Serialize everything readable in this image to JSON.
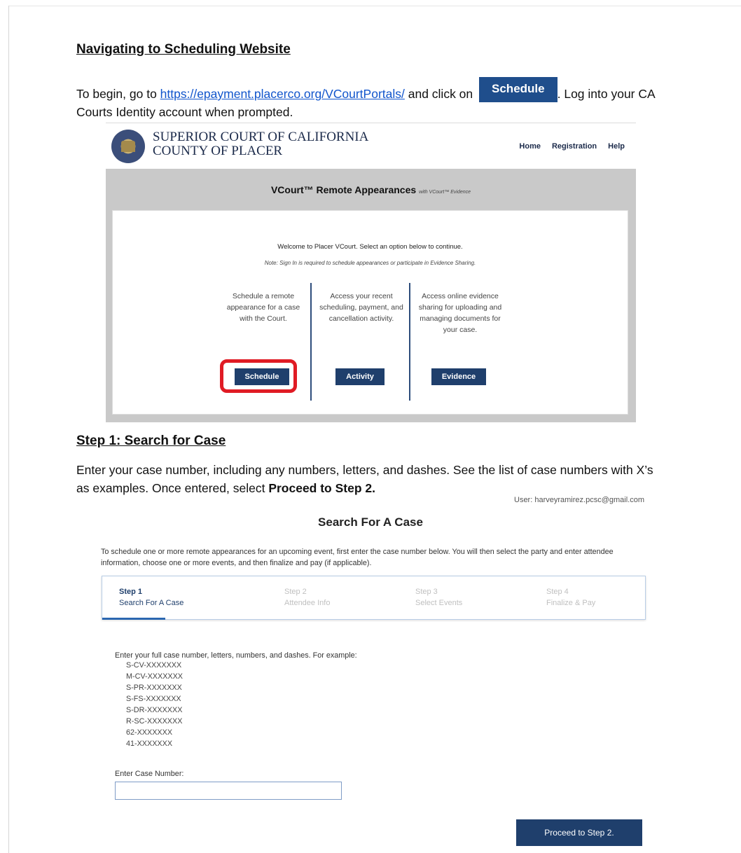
{
  "section1": {
    "heading": "Navigating to Scheduling Website",
    "intro_before": "To begin, go to ",
    "link": "https://epayment.placerco.org/VCourtPortals/",
    "intro_middle": " and click on ",
    "inline_button": "Schedule",
    "intro_after": ". Log into your CA Courts Identity account when prompted."
  },
  "vcourt": {
    "court_line1": "SUPERIOR COURT OF CALIFORNIA",
    "court_line2": "COUNTY OF PLACER",
    "nav": [
      "Home",
      "Registration",
      "Help"
    ],
    "band_title": "VCourt™ Remote Appearances",
    "band_subtitle": "with VCourt™ Evidence",
    "welcome": "Welcome to Placer VCourt. Select an option below to continue.",
    "note": "Note: Sign In is required to schedule appearances or participate in Evidence Sharing.",
    "options": [
      {
        "text": "Schedule a remote appearance for a case with the Court.",
        "button": "Schedule"
      },
      {
        "text": "Access your recent scheduling, payment, and cancellation activity.",
        "button": "Activity"
      },
      {
        "text": "Access online evidence sharing for uploading and managing documents for your case.",
        "button": "Evidence"
      }
    ]
  },
  "section2": {
    "heading": "Step 1: Search for Case",
    "para_text": "Enter your case number, including any numbers, letters, and dashes. See the list of case numbers with X’s as examples. Once entered, select ",
    "para_bold": "Proceed to Step 2."
  },
  "search": {
    "user": "User: harveyramirez.pcsc@gmail.com",
    "title": "Search For A Case",
    "intro": "To schedule one or more remote appearances for an upcoming event, first enter the case number below. You will then select the party and enter attendee information, choose one or more events, and then finalize and pay (if applicable).",
    "steps": [
      {
        "num": "Step 1",
        "label": "Search For A Case"
      },
      {
        "num": "Step 2",
        "label": "Attendee Info"
      },
      {
        "num": "Step 3",
        "label": "Select Events"
      },
      {
        "num": "Step 4",
        "label": "Finalize & Pay"
      }
    ],
    "instructions": "Enter your full case number, letters, numbers, and dashes. For example:",
    "examples": [
      "S-CV-XXXXXXX",
      "M-CV-XXXXXXX",
      "S-PR-XXXXXXX",
      "S-FS-XXXXXXX",
      "S-DR-XXXXXXX",
      "R-SC-XXXXXXX",
      "62-XXXXXXX",
      "41-XXXXXXX"
    ],
    "case_label": "Enter Case Number:",
    "case_value": "",
    "proceed": "Proceed to Step 2."
  },
  "colors": {
    "accent": "#1f3f6c",
    "highlight": "#e01b24",
    "link": "#1155cc"
  }
}
